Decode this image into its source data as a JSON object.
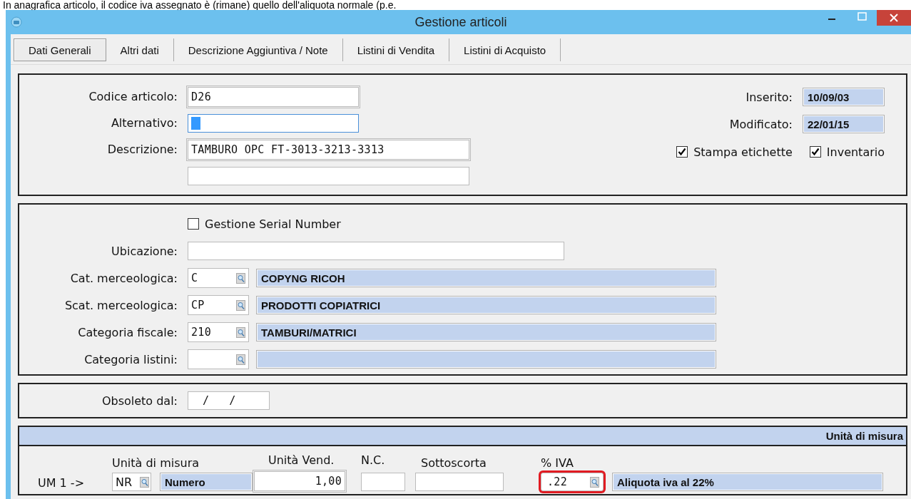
{
  "caption": "In anagrafica articolo, il codice iva assegnato è (rimane) quello dell'aliquota normale (p.e.",
  "window": {
    "title": "Gestione articoli"
  },
  "tabs": [
    {
      "label": "Dati Generali",
      "selected": true
    },
    {
      "label": "Altri dati",
      "selected": false
    },
    {
      "label": "Descrizione Aggiuntiva / Note",
      "selected": false
    },
    {
      "label": "Listini di Vendita",
      "selected": false
    },
    {
      "label": "Listini di Acquisto",
      "selected": false
    }
  ],
  "general": {
    "codice": {
      "label": "Codice articolo:",
      "value": "D26"
    },
    "alternativo": {
      "label": "Alternativo:",
      "focused": true
    },
    "descrizione": {
      "label": "Descrizione:",
      "value": "TAMBURO OPC FT-3013-3213-3313"
    },
    "inserito": {
      "label": "Inserito:",
      "value": "10/09/03"
    },
    "modificato": {
      "label": "Modificato:",
      "value": "22/01/15"
    },
    "checks": [
      {
        "label": "Stampa etichette",
        "checked": true
      },
      {
        "label": "Inventario",
        "checked": true
      }
    ]
  },
  "details": {
    "serial": {
      "label": "Gestione Serial Number",
      "checked": false
    },
    "ubicazione": {
      "label": "Ubicazione:"
    },
    "categories": [
      {
        "label": "Cat. merceologica:",
        "code": "C",
        "description": "COPYNG RICOH"
      },
      {
        "label": "Scat. merceologica:",
        "code": "CP",
        "description": "PRODOTTI COPIATRICI"
      },
      {
        "label": "Categoria fiscale:",
        "code": "210",
        "description": "TAMBURI/MATRICI"
      },
      {
        "label": "Categoria listini:"
      }
    ]
  },
  "obsoleto": {
    "label": "Obsoleto dal:",
    "value": "/   /"
  },
  "units": {
    "header": "Unità di misura",
    "row_label": "UM 1 ->",
    "um": {
      "label": "Unità di misura",
      "code": "NR",
      "description": "Numero"
    },
    "vend": {
      "label": "Unità Vend.",
      "value": "1,00"
    },
    "nc": {
      "label": "N.C."
    },
    "sottoscorta": {
      "label": "Sottoscorta"
    },
    "iva": {
      "label": "% IVA",
      "code": ".22",
      "description": "Aliquota iva al 22%",
      "highlighted": true
    }
  }
}
